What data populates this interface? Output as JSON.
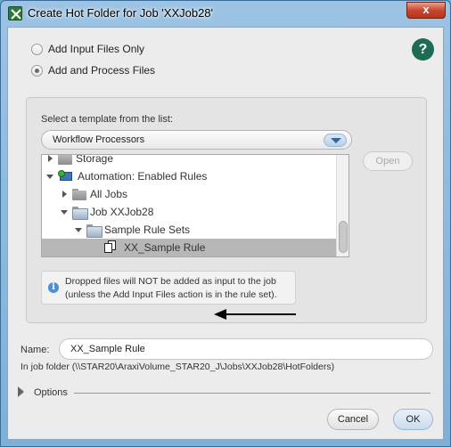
{
  "window": {
    "title": "Create Hot Folder for Job 'XXJob28'",
    "close_glyph": "x"
  },
  "mode_options": [
    {
      "label": "Add Input Files Only",
      "selected": false
    },
    {
      "label": "Add and Process Files",
      "selected": true
    }
  ],
  "help": {
    "glyph": "?"
  },
  "template": {
    "label": "Select a template from the list:",
    "selected": "Workflow Processors"
  },
  "tree": {
    "items": [
      {
        "label": "Storage",
        "level": 0,
        "expander": "closed",
        "icon": "folder-icon"
      },
      {
        "label": "Automation: Enabled Rules",
        "level": 0,
        "expander": "open",
        "icon": "automation-icon"
      },
      {
        "label": "All Jobs",
        "level": 1,
        "expander": "closed",
        "icon": "folder-icon"
      },
      {
        "label": "Job XXJob28",
        "level": 1,
        "expander": "open",
        "icon": "open-folder-icon"
      },
      {
        "label": "Sample Rule Sets",
        "level": 2,
        "expander": "open",
        "icon": "open-folder-icon"
      },
      {
        "label": "XX_Sample Rule",
        "level": 3,
        "expander": "none",
        "icon": "rule-icon",
        "selected": true
      }
    ]
  },
  "open_button": {
    "label": "Open",
    "enabled": false
  },
  "info": {
    "line1": "Dropped files will NOT be added as input to the job",
    "line2": "(unless the Add Input Files action is in the rule set)."
  },
  "name": {
    "label": "Name:",
    "value": "XX_Sample Rule"
  },
  "job_folder_path": "In job folder (\\\\STAR20\\AraxiVolume_STAR20_J\\Jobs\\XXJob28\\HotFolders)",
  "options": {
    "label": "Options",
    "expanded": false
  },
  "buttons": {
    "cancel": "Cancel",
    "ok": "OK"
  },
  "colors": {
    "accent": "#1e6b56",
    "selection": "#b7b7b7",
    "title_bar": "#7eb0d8"
  }
}
